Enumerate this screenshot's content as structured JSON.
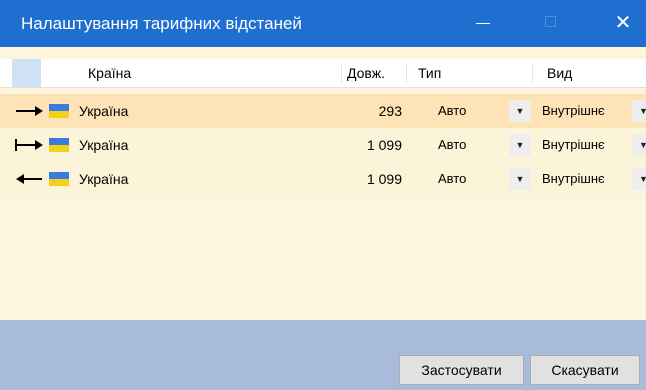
{
  "window": {
    "title": "Налаштування тарифних відстаней",
    "close_glyph": "✕"
  },
  "columns": {
    "country": "Країна",
    "length": "Довж.",
    "type": "Тип",
    "kind": "Вид"
  },
  "rows": [
    {
      "direction_icon": "arrow-right-icon",
      "flag_icon": "ukraine-flag-icon",
      "country": "Україна",
      "length": "293",
      "type": "Авто",
      "kind": "Внутрішнє",
      "selected": true
    },
    {
      "direction_icon": "arrow-right-from-bar-icon",
      "flag_icon": "ukraine-flag-icon",
      "country": "Україна",
      "length": "1 099",
      "type": "Авто",
      "kind": "Внутрішнє",
      "selected": false
    },
    {
      "direction_icon": "arrow-left-icon",
      "flag_icon": "ukraine-flag-icon",
      "country": "Україна",
      "length": "1 099",
      "type": "Авто",
      "kind": "Внутрішнє",
      "selected": false
    }
  ],
  "dropdown_glyph": "▼",
  "buttons": {
    "apply": "Застосувати",
    "cancel": "Скасувати"
  },
  "colors": {
    "titlebar": "#1f6fd1",
    "selected_row": "#fde3b5",
    "row_background": "#fbf4d8",
    "footer": "#a9bbdb",
    "flag_blue": "#3a7be0",
    "flag_yellow": "#f2d11b"
  }
}
